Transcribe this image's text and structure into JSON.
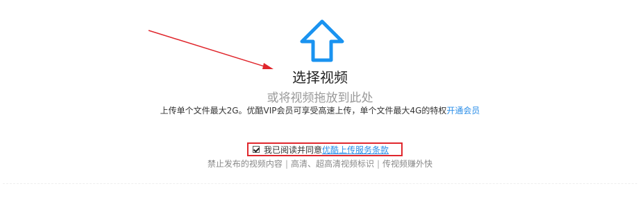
{
  "upload": {
    "title": "选择视频",
    "drag_hint": "或将视频拖放到此处",
    "limit_text": "上传单个文件最大2G。优酷VIP会员可享受高速上传，单个文件最大4G的特权",
    "vip_link": "开通会员"
  },
  "agreement": {
    "checked": true,
    "label": "我已阅读并同意",
    "terms_link": "优酷上传服务条款"
  },
  "notices": {
    "items": [
      "禁止发布的视频内容",
      "高清、超高清视频标识",
      "传视频赚外快"
    ],
    "separator": "|"
  },
  "colors": {
    "icon_blue": "#1a93f0",
    "link_blue": "#2a8ee8",
    "annotation_red": "#e0262c"
  }
}
